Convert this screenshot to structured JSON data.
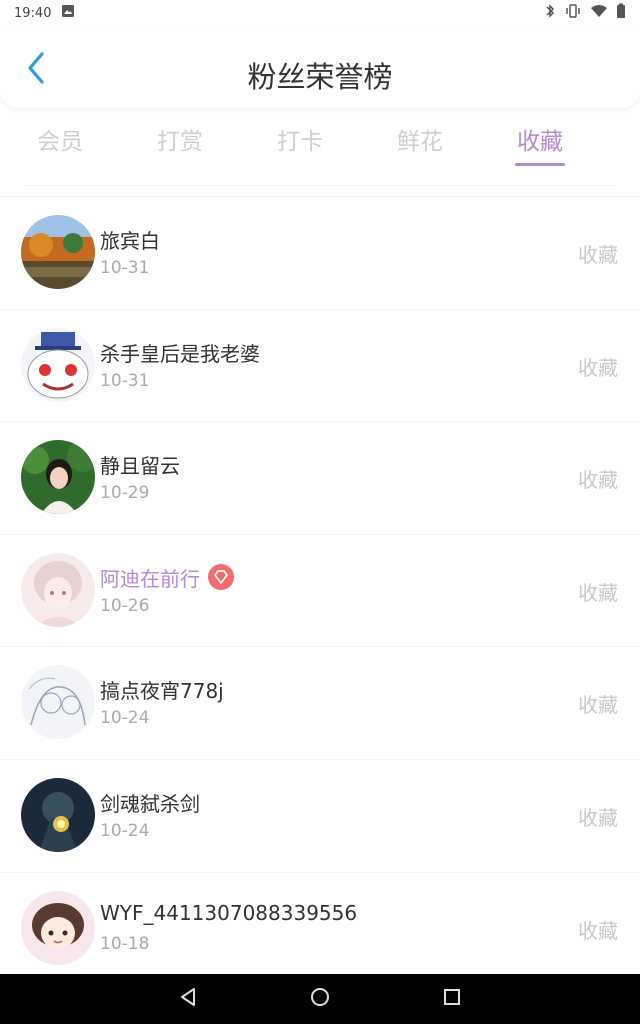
{
  "status_bar": {
    "time": "19:40"
  },
  "header": {
    "title": "粉丝荣誉榜"
  },
  "tabs": [
    {
      "label": "会员",
      "active": false
    },
    {
      "label": "打赏",
      "active": false
    },
    {
      "label": "打卡",
      "active": false
    },
    {
      "label": "鲜花",
      "active": false
    },
    {
      "label": "收藏",
      "active": true
    }
  ],
  "fans": [
    {
      "name": "旅宾白",
      "date": "10-31",
      "action": "收藏",
      "avatar": "landscape-avatar",
      "vip": false
    },
    {
      "name": "杀手皇后是我老婆",
      "date": "10-31",
      "action": "收藏",
      "avatar": "cartoon-face-avatar",
      "vip": false
    },
    {
      "name": "静且留云",
      "date": "10-29",
      "action": "收藏",
      "avatar": "girl-photo-avatar",
      "vip": false
    },
    {
      "name": "阿迪在前行",
      "date": "10-26",
      "action": "收藏",
      "avatar": "anime-girl-avatar",
      "vip": true
    },
    {
      "name": "搞点夜宵778j",
      "date": "10-24",
      "action": "收藏",
      "avatar": "sketch-avatar",
      "vip": false
    },
    {
      "name": "剑魂弑杀剑",
      "date": "10-24",
      "action": "收藏",
      "avatar": "game-hero-avatar",
      "vip": false
    },
    {
      "name": "WYF_4411307088339556",
      "date": "10-18",
      "action": "收藏",
      "avatar": "chibi-avatar",
      "vip": false
    }
  ],
  "colors": {
    "accent": "#b58ad8",
    "badge": "#f26d6d",
    "back_icon": "#2a9ee8"
  }
}
